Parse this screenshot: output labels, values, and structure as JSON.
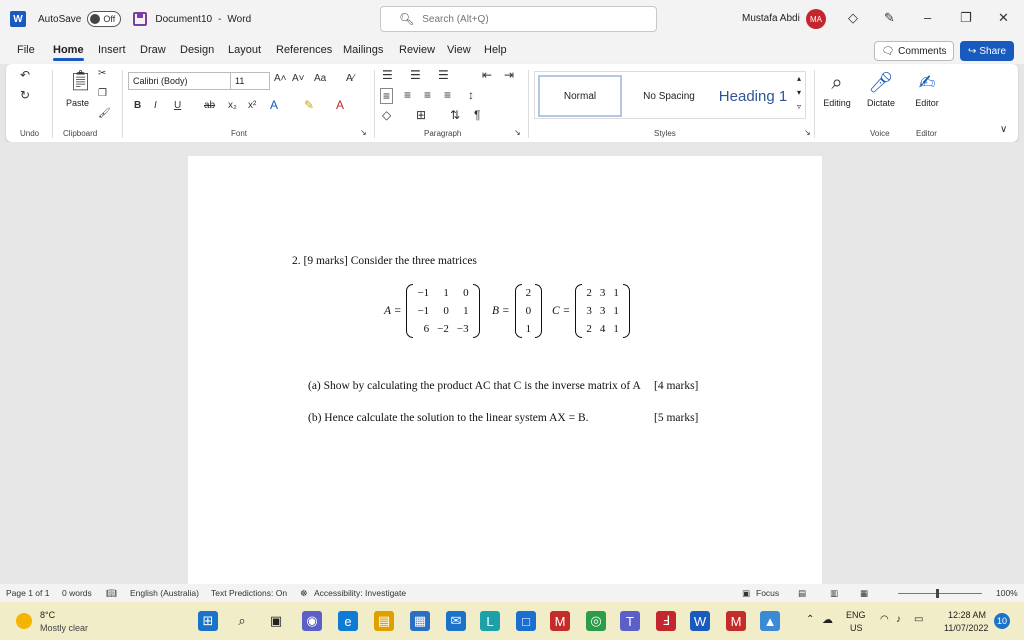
{
  "titlebar": {
    "autosave_label": "AutoSave",
    "autosave_state": "Off",
    "doc_title": "Document10",
    "title_sep": "-",
    "app_name": "Word",
    "search_placeholder": "Search (Alt+Q)",
    "user_name": "Mustafa Abdi",
    "user_initials": "MA"
  },
  "tabs": [
    "File",
    "Home",
    "Insert",
    "Draw",
    "Design",
    "Layout",
    "References",
    "Mailings",
    "Review",
    "View",
    "Help"
  ],
  "active_tab": "Home",
  "actions": {
    "comments": "Comments",
    "share": "Share"
  },
  "ribbon": {
    "paste_label": "Paste",
    "font_name": "Calibri (Body)",
    "font_size": "11",
    "styles": {
      "normal": "Normal",
      "no_spacing": "No Spacing",
      "heading1": "Heading 1"
    },
    "editing": "Editing",
    "dictate": "Dictate",
    "editor": "Editor",
    "groups": {
      "undo": "Undo",
      "clipboard": "Clipboard",
      "font": "Font",
      "paragraph": "Paragraph",
      "styles": "Styles",
      "voice": "Voice",
      "editor": "Editor"
    }
  },
  "document": {
    "question": "2. [9 marks] Consider the three matrices",
    "matrix_A_label": "A =",
    "matrix_A": [
      [
        "−1",
        "1",
        "0"
      ],
      [
        "−1",
        "0",
        "1"
      ],
      [
        "6",
        "−2",
        "−3"
      ]
    ],
    "matrix_B_label": "B =",
    "matrix_B": [
      [
        "2"
      ],
      [
        "0"
      ],
      [
        "1"
      ]
    ],
    "matrix_C_label": "C =",
    "matrix_C": [
      [
        "2",
        "3",
        "1"
      ],
      [
        "3",
        "3",
        "1"
      ],
      [
        "2",
        "4",
        "1"
      ]
    ],
    "part_a": "(a) Show by calculating the product AC that C is the inverse matrix of A",
    "part_a_marks": "[4 marks]",
    "part_b": "(b) Hence calculate the solution to the linear system AX = B.",
    "part_b_marks": "[5 marks]"
  },
  "status": {
    "page": "Page 1 of 1",
    "words": "0 words",
    "language": "English (Australia)",
    "predictions": "Text Predictions: On",
    "accessibility": "Accessibility: Investigate",
    "focus": "Focus",
    "zoom": "100%"
  },
  "taskbar": {
    "temp": "8°C",
    "weather": "Mostly clear",
    "lang_line1": "ENG",
    "lang_line2": "US",
    "time": "12:28 AM",
    "date": "11/07/2022",
    "notifications": "10"
  },
  "colors": {
    "accent": "#185abd",
    "avatar": "#c4262e",
    "taskbar": "#f1edc9"
  }
}
